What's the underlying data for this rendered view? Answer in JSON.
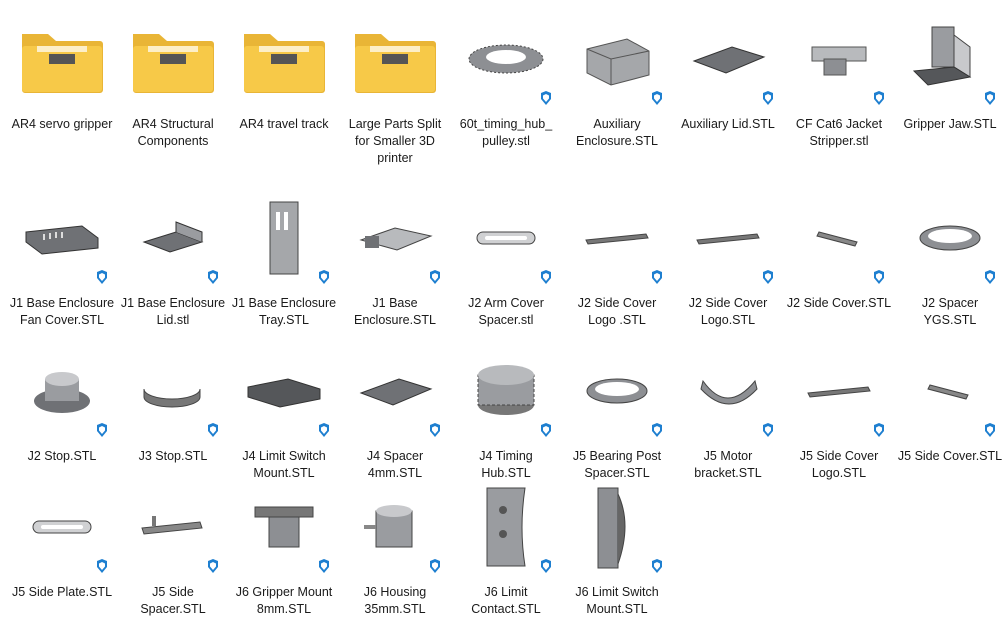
{
  "items": [
    {
      "name": "AR4 servo gripper",
      "kind": "folder",
      "icon": "folder-icon"
    },
    {
      "name": "AR4 Structural Components",
      "kind": "folder",
      "icon": "folder-icon"
    },
    {
      "name": "AR4 travel track",
      "kind": "folder",
      "icon": "folder-icon"
    },
    {
      "name": "Large Parts Split for Smaller 3D printer",
      "kind": "folder",
      "icon": "folder-icon"
    },
    {
      "name": "60t_timing_hub_ pulley.stl",
      "kind": "stl",
      "icon": "gear-ring-icon"
    },
    {
      "name": "Auxiliary Enclosure.STL",
      "kind": "stl",
      "icon": "box-enclosure-icon"
    },
    {
      "name": "Auxiliary Lid.STL",
      "kind": "stl",
      "icon": "plate-icon"
    },
    {
      "name": "CF Cat6 Jacket Stripper.stl",
      "kind": "stl",
      "icon": "hinge-icon"
    },
    {
      "name": "Gripper Jaw.STL",
      "kind": "stl",
      "icon": "bracket-icon"
    },
    {
      "name": "J1 Base Enclosure Fan Cover.STL",
      "kind": "stl",
      "icon": "fan-cover-icon"
    },
    {
      "name": "J1 Base Enclosure Lid.stl",
      "kind": "stl",
      "icon": "lid-icon"
    },
    {
      "name": "J1 Base Enclosure Tray.STL",
      "kind": "stl",
      "icon": "tray-icon"
    },
    {
      "name": "J1 Base Enclosure.STL",
      "kind": "stl",
      "icon": "enclosure-icon"
    },
    {
      "name": "J2 Arm Cover Spacer.stl",
      "kind": "stl",
      "icon": "slot-icon"
    },
    {
      "name": "J2 Side Cover Logo .STL",
      "kind": "stl",
      "icon": "logo-icon"
    },
    {
      "name": "J2 Side Cover Logo.STL",
      "kind": "stl",
      "icon": "logo-icon"
    },
    {
      "name": "J2 Side Cover.STL",
      "kind": "stl",
      "icon": "strip-icon"
    },
    {
      "name": "J2 Spacer YGS.STL",
      "kind": "stl",
      "icon": "ring-icon"
    },
    {
      "name": "J2 Stop.STL",
      "kind": "stl",
      "icon": "stop-icon"
    },
    {
      "name": "J3 Stop.STL",
      "kind": "stl",
      "icon": "stop-small-icon"
    },
    {
      "name": "J4 Limit Switch Mount.STL",
      "kind": "stl",
      "icon": "block-icon"
    },
    {
      "name": "J4 Spacer 4mm.STL",
      "kind": "stl",
      "icon": "plate-icon"
    },
    {
      "name": "J4 Timing Hub.STL",
      "kind": "stl",
      "icon": "gear-hub-icon"
    },
    {
      "name": "J5 Bearing Post Spacer.STL",
      "kind": "stl",
      "icon": "ring-icon"
    },
    {
      "name": "J5 Motor bracket.STL",
      "kind": "stl",
      "icon": "arc-bracket-icon"
    },
    {
      "name": "J5 Side Cover Logo.STL",
      "kind": "stl",
      "icon": "logo-icon"
    },
    {
      "name": "J5 Side Cover.STL",
      "kind": "stl",
      "icon": "strip-icon"
    },
    {
      "name": "J5 Side Plate.STL",
      "kind": "stl",
      "icon": "slot-icon"
    },
    {
      "name": "J5 Side Spacer.STL",
      "kind": "stl",
      "icon": "spacer-icon"
    },
    {
      "name": "J6 Gripper Mount 8mm.STL",
      "kind": "stl",
      "icon": "mount-icon"
    },
    {
      "name": "J6 Housing 35mm.STL",
      "kind": "stl",
      "icon": "housing-icon"
    },
    {
      "name": "J6 Limit Contact.STL",
      "kind": "stl",
      "icon": "curved-plate-icon"
    },
    {
      "name": "J6 Limit Switch Mount.STL",
      "kind": "stl",
      "icon": "tall-bracket-icon"
    }
  ],
  "colors": {
    "folder": "#f7c948",
    "folder_back": "#e9b536",
    "part": "#8d8f93",
    "badge": "#1e7fd0"
  }
}
